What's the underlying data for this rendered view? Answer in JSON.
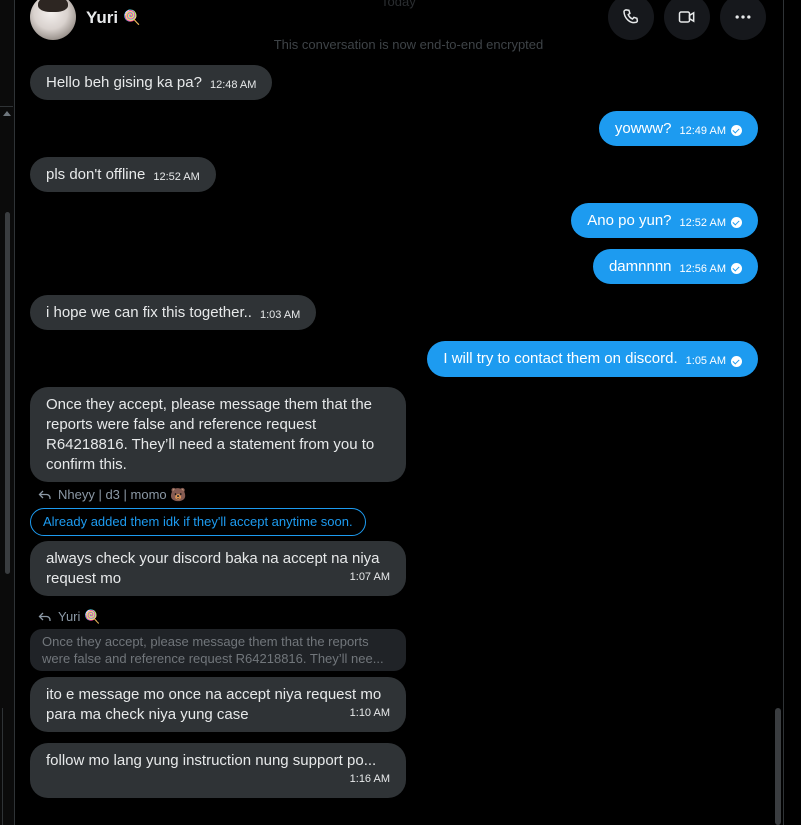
{
  "header": {
    "faded_top": "Today",
    "user_name": "Yuri",
    "user_emoji": "🍭",
    "encryption_notice": "This conversation is now end-to-end encrypted"
  },
  "messages": [
    {
      "dir": "in",
      "text": "Hello beh gising ka pa?",
      "time": "12:48 AM"
    },
    {
      "dir": "out",
      "text": "yowww?",
      "time": "12:49 AM"
    },
    {
      "dir": "in",
      "text": "pls don't offline",
      "time": "12:52 AM"
    },
    {
      "dir": "out",
      "text": "Ano po yun?",
      "time": "12:52 AM"
    },
    {
      "dir": "out",
      "text": "damnnnn",
      "time": "12:56 AM"
    },
    {
      "dir": "in",
      "text": "i hope we can fix this together..",
      "time": "1:03 AM"
    },
    {
      "dir": "out",
      "text": "I will try to contact them on discord.",
      "time": "1:05 AM"
    },
    {
      "dir": "in",
      "text": "Once they accept, please message them that the reports were false and reference request R64218816. They’ll need a statement from you to confirm this.",
      "time": ""
    },
    {
      "dir": "in",
      "text": "always check your discord baka na accept na niya request mo",
      "time": "1:07 AM",
      "reply_to": "Nheyy | d3 | momo 🐻",
      "reply_quote": "Already added them idk if they'll accept anytime soon."
    },
    {
      "dir": "in",
      "text": "ito e message mo once na accept niya request mo para ma check niya yung case",
      "time": "1:10 AM",
      "reply_to": "Yuri 🍭",
      "reply_quote": "Once they accept, please message them that the reports were false and reference request R64218816. They’ll nee..."
    },
    {
      "dir": "in",
      "text": "follow mo lang yung instruction nung support po...",
      "time": "1:16 AM"
    }
  ],
  "colors": {
    "outgoing": "#1d9bf0",
    "incoming": "#2f3336",
    "background": "#000000"
  },
  "icons": [
    "phone-icon",
    "video-camera-icon",
    "more-dots-icon",
    "reply-arrow-icon",
    "check-circle-icon"
  ]
}
